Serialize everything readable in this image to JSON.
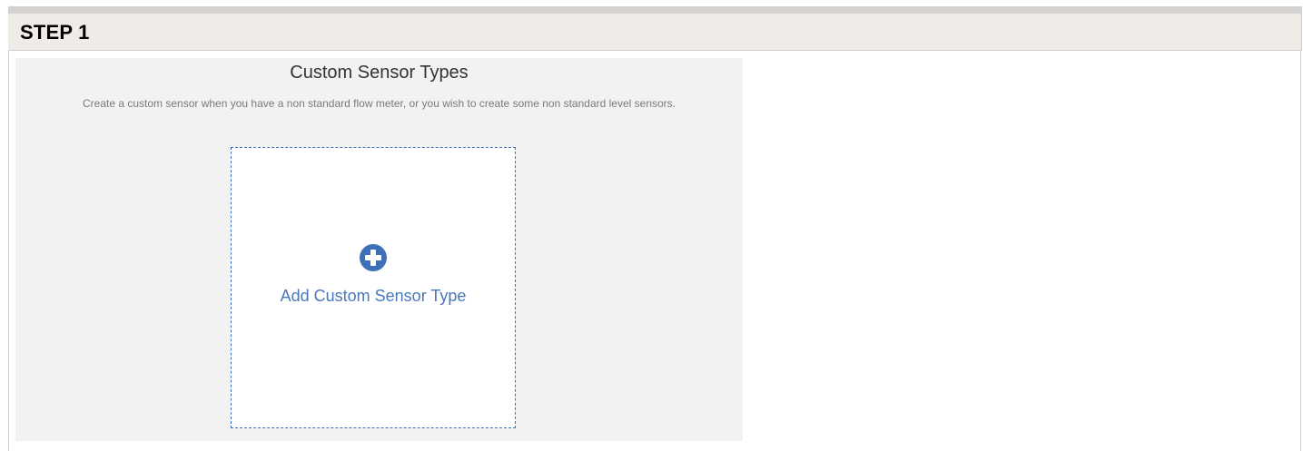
{
  "step": {
    "title": "STEP 1"
  },
  "panel": {
    "title": "Custom Sensor Types",
    "description": "Create a custom sensor when you have a non standard flow meter, or you wish to create some non standard level sensors."
  },
  "add_card": {
    "icon": "plus-circle-icon",
    "label": "Add Custom Sensor Type"
  },
  "colors": {
    "accent": "#3f6fb6",
    "header_bg": "#efece8",
    "panel_bg": "#f2f2f2"
  }
}
